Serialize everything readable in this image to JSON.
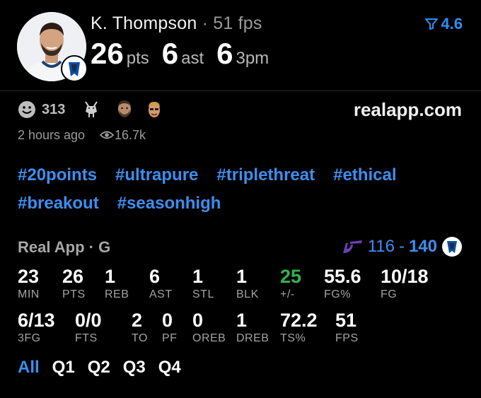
{
  "player": {
    "name": "K. Thompson",
    "separator": "·",
    "fps": "51 fps",
    "rating": "4.6",
    "rating_icon": "filter-icon",
    "headline": [
      {
        "value": "26",
        "unit": "pts"
      },
      {
        "value": "6",
        "unit": "ast"
      },
      {
        "value": "6",
        "unit": "3pm"
      }
    ]
  },
  "post": {
    "reaction_count": "313",
    "site": "realapp.com",
    "posted": "2 hours ago",
    "views": "16.7k"
  },
  "hashtags": [
    "#20points",
    "#ultrapure",
    "#triplethreat",
    "#ethical",
    "#breakout",
    "#seasonhigh"
  ],
  "game": {
    "label": "Real App · G",
    "score_left": "116",
    "score_right": "140"
  },
  "stats_row1": [
    {
      "v": "23",
      "l": "MIN"
    },
    {
      "v": "26",
      "l": "PTS"
    },
    {
      "v": "1",
      "l": "REB"
    },
    {
      "v": "6",
      "l": "AST"
    },
    {
      "v": "1",
      "l": "STL"
    },
    {
      "v": "1",
      "l": "BLK"
    },
    {
      "v": "25",
      "l": "+/-"
    },
    {
      "v": "55.6",
      "l": "FG%"
    },
    {
      "v": "10/18",
      "l": "FG"
    }
  ],
  "stats_row2": [
    {
      "v": "6/13",
      "l": "3FG"
    },
    {
      "v": "0/0",
      "l": "FTS"
    },
    {
      "v": "2",
      "l": "TO"
    },
    {
      "v": "0",
      "l": "PF"
    },
    {
      "v": "0",
      "l": "OREB"
    },
    {
      "v": "1",
      "l": "DREB"
    },
    {
      "v": "72.2",
      "l": "TS%"
    },
    {
      "v": "51",
      "l": "FPS"
    }
  ],
  "tabs": [
    "All",
    "Q1",
    "Q2",
    "Q3",
    "Q4"
  ],
  "colors": {
    "accent": "#3d8ef0",
    "positive": "#34b24f",
    "background": "#000000"
  }
}
